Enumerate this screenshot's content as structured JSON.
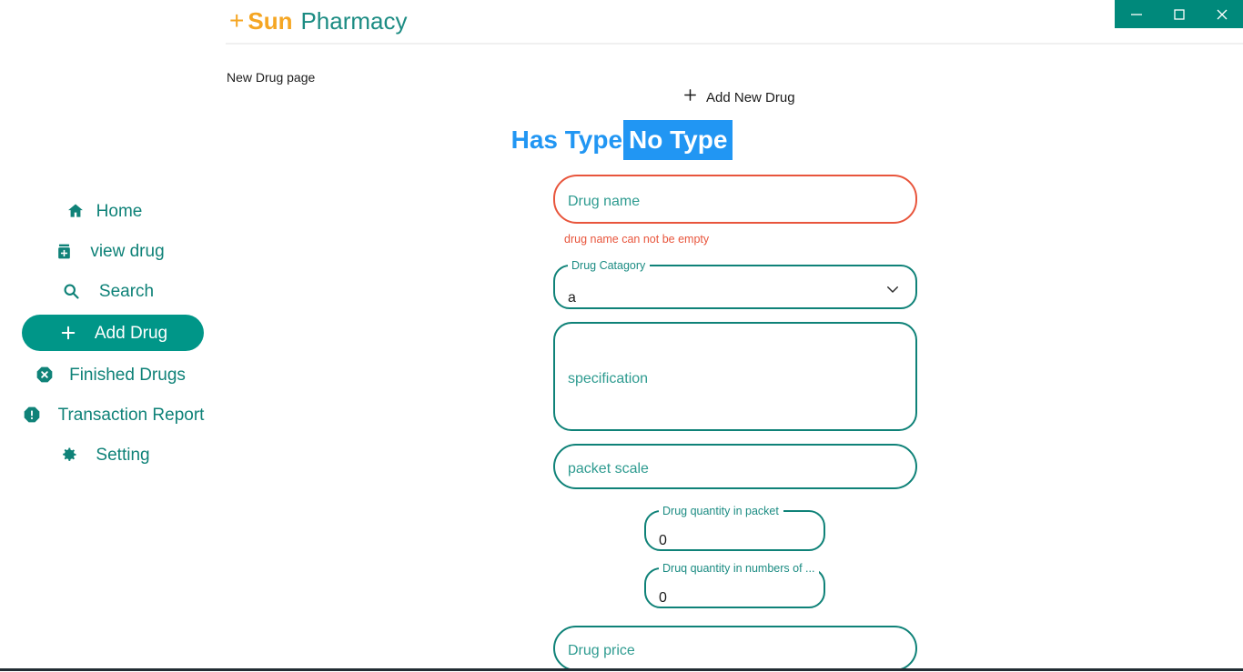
{
  "window": {
    "controls": [
      {
        "name": "minimize",
        "glyph": "minimize-icon"
      },
      {
        "name": "maximize",
        "glyph": "maximize-icon"
      },
      {
        "name": "close",
        "glyph": "close-icon"
      }
    ],
    "titlebar_color": "#00897B"
  },
  "brand": {
    "plus": "+",
    "name_bold": "Sun",
    "name_rest": "Pharmacy",
    "accent_color": "#F5A623",
    "teal_color": "#1C8C83"
  },
  "sidebar": {
    "items": [
      {
        "label": "Home",
        "icon": "home-icon",
        "active": false
      },
      {
        "label": "view drug",
        "icon": "pill-bottle-icon",
        "active": false
      },
      {
        "label": "Search",
        "icon": "search-icon",
        "active": false
      },
      {
        "label": "Add Drug",
        "icon": "plus-icon",
        "active": true
      },
      {
        "label": "Finished Drugs",
        "icon": "x-octagon-icon",
        "active": false
      },
      {
        "label": "Transaction Report",
        "icon": "alert-octagon-icon",
        "active": false
      },
      {
        "label": "Setting",
        "icon": "gear-icon",
        "active": false
      }
    ],
    "active_color": "#009688"
  },
  "page": {
    "label": "New Drug page",
    "add_new_drug": "Add New Drug",
    "add_new_drug_icon": "plus-icon"
  },
  "type_toggle": {
    "options": [
      {
        "label": "Has Type",
        "selected": false
      },
      {
        "label": "No Type",
        "selected": true
      }
    ],
    "color": "#2196F3",
    "selected_text_color": "#FFFFFF"
  },
  "form": {
    "drug_name": {
      "placeholder": "Drug name",
      "value": "",
      "error": "drug name can not be empty",
      "error_color": "#E8553C",
      "has_error": true
    },
    "drug_category": {
      "legend": "Drug Catagory",
      "value": "a",
      "chevron": "chevron-down-icon"
    },
    "specification": {
      "placeholder": "specification",
      "value": ""
    },
    "packet_scale": {
      "placeholder": "packet scale",
      "value": ""
    },
    "quantity_in_packet": {
      "legend": "Drug quantity in packet",
      "value": "0"
    },
    "quantity_in_numbers": {
      "legend": "Druq quantity in numbers of ...",
      "value": "0"
    },
    "drug_price": {
      "placeholder": "Drug price",
      "value": ""
    },
    "border_color": "#0F8278",
    "placeholder_color": "#2E9B90"
  }
}
